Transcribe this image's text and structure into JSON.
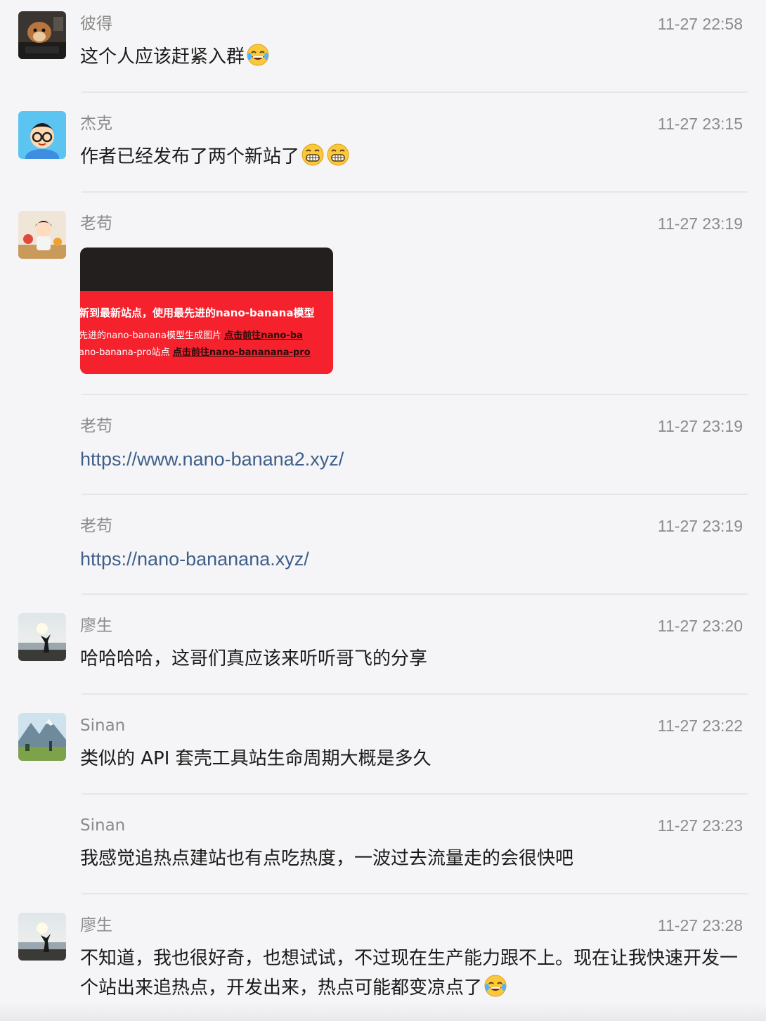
{
  "messages": [
    {
      "sender": "彼得",
      "time": "11-27 22:58",
      "text": "这个人应该赶紧入群",
      "emojis": [
        "joy-emoji"
      ]
    },
    {
      "sender": "杰克",
      "time": "11-27 23:15",
      "text": "作者已经发布了两个新站了",
      "emojis": [
        "grin-emoji",
        "grin-emoji"
      ]
    },
    {
      "sender": "老苟",
      "time": "11-27 23:19",
      "image": {
        "line1": "新到最新站点，使用最先进的nano-banana模型",
        "line2_text": "先进的nano-banana模型生成图片 ",
        "line2_link": "点击前往nano-ba",
        "line3_text": "ano-banana-pro站点 ",
        "line3_link": "点击前往nano-bananana-pro"
      }
    },
    {
      "sender": "老苟",
      "time": "11-27 23:19",
      "link": "https://www.nano-banana2.xyz/"
    },
    {
      "sender": "老苟",
      "time": "11-27 23:19",
      "link": "https://nano-bananana.xyz/"
    },
    {
      "sender": "廖生",
      "time": "11-27 23:20",
      "text": "哈哈哈哈，这哥们真应该来听听哥飞的分享"
    },
    {
      "sender": "Sinan",
      "time": "11-27 23:22",
      "text": "类似的 API 套壳工具站生命周期大概是多久"
    },
    {
      "sender": "Sinan",
      "time": "11-27 23:23",
      "text": "我感觉追热点建站也有点吃热度，一波过去流量走的会很快吧"
    },
    {
      "sender": "廖生",
      "time": "11-27 23:28",
      "text": "不知道，我也很好奇，也想试试，不过现在生产能力跟不上。现在让我快速开发一个站出来追热点，开发出来，热点可能都变凉点了",
      "emojis": [
        "joy-emoji"
      ]
    }
  ]
}
